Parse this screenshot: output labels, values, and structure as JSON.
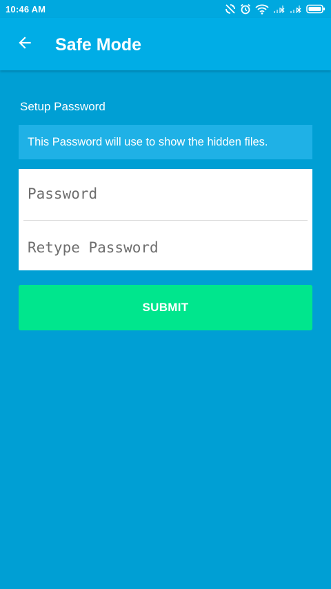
{
  "status_bar": {
    "time": "10:46 AM",
    "icons": [
      "sync-off-icon",
      "alarm-icon",
      "wifi-icon",
      "signal-icon",
      "signal-icon",
      "battery-icon"
    ]
  },
  "app_bar": {
    "title": "Safe Mode",
    "back_icon": "arrow-left-icon"
  },
  "form": {
    "section_label": "Setup Password",
    "info_text": "This Password will use to show the hidden files.",
    "password_field": {
      "placeholder": "Password",
      "value": ""
    },
    "retype_field": {
      "placeholder": "Retype Password",
      "value": ""
    },
    "submit_label": "SUBMIT"
  },
  "colors": {
    "background": "#009fd4",
    "app_bar": "#00ade6",
    "info_banner": "#1fb1e6",
    "submit": "#00e68d"
  }
}
